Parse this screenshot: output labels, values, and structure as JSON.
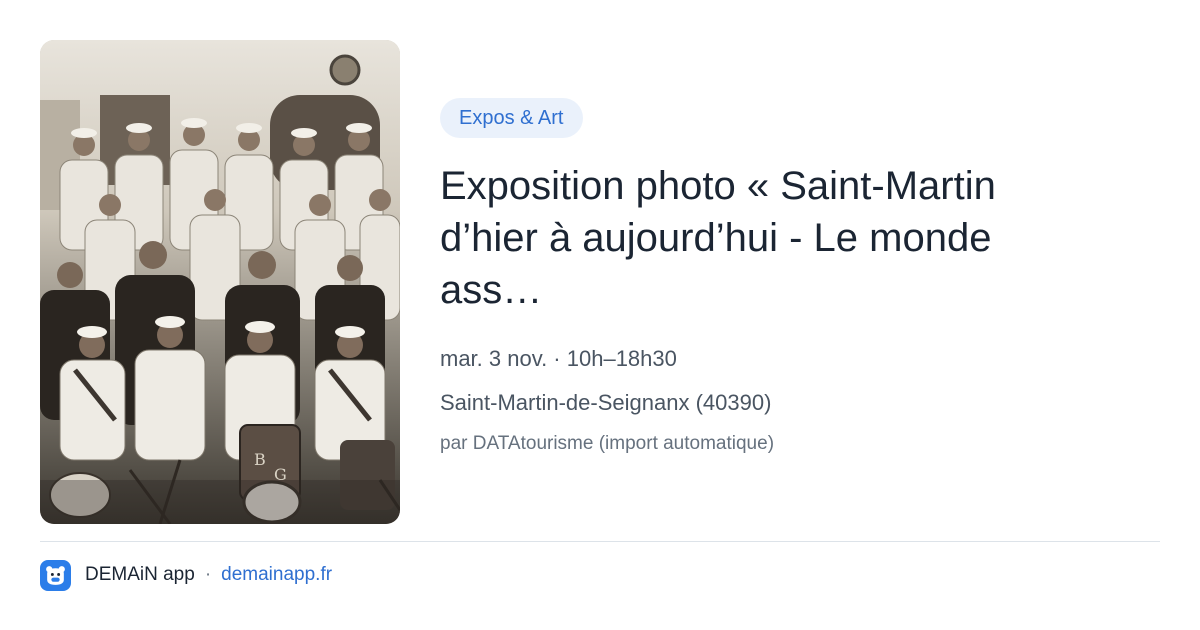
{
  "card": {
    "tag": "Expos & Art",
    "title": "Exposition photo « Saint-Martin d’hier à aujourd’hui - Le monde ass…",
    "when": "mar. 3 nov. · 10h–18h30",
    "where": "Saint-Martin-de-Seignanx (40390)",
    "source": "par DATAtourisme (import automatique)"
  },
  "footer": {
    "app_name": "DEMAiN app",
    "separator": "·",
    "domain": "demainapp.fr"
  },
  "photo": {
    "icon": "vintage-group-photo",
    "drum_letters": [
      "B",
      "G"
    ]
  },
  "colors": {
    "accent": "#2f6fd0",
    "tag_bg": "#eaf1fb",
    "title": "#1b2533",
    "meta": "#4a5562",
    "app_icon": "#2b7de9"
  }
}
